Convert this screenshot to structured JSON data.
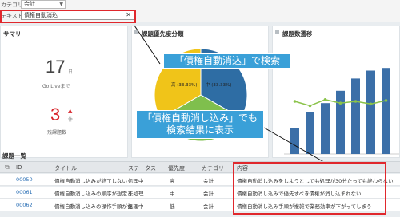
{
  "filters": {
    "category_label": "カテゴリ",
    "category_value": "会計",
    "text_label": "テキスト",
    "text_value": "債権自動消込"
  },
  "summary": {
    "title": "サマリ",
    "days_left": "17",
    "days_unit": "日",
    "go_live_label": "Go Liveまで",
    "remaining": "3",
    "remaining_unit": "件",
    "remaining_label": "残課題数"
  },
  "priority_panel": {
    "title": "課題優先度分類",
    "pie_high": "高 (33.33%)",
    "pie_mid": "中 (33.33%)",
    "pie_values": [
      33.33,
      33.33,
      33.34
    ],
    "colors": {
      "high": "#2e6da4",
      "mid": "#7fbf4d",
      "low": "#f0c419"
    }
  },
  "trend_panel": {
    "title": "課題数遷移",
    "bars": [
      0.3,
      0.48,
      0.58,
      0.72,
      0.86,
      0.95,
      0.98
    ],
    "line": [
      0.6,
      0.55,
      0.62,
      0.58,
      0.6,
      0.57,
      0.61
    ]
  },
  "callouts": {
    "top": "「債権自動消込」で検索",
    "bottom_line1": "「債権自動消し込み」でも",
    "bottom_line2": "検索結果に表示"
  },
  "list": {
    "title": "課題一覧",
    "headers": {
      "id": "ID",
      "title": "タイトル",
      "status": "ステータス",
      "priority": "優先度",
      "category": "カテゴリ",
      "content": "内容"
    },
    "rows": [
      {
        "id": "00050",
        "title": "債権自動消し込みが終了しない",
        "status": "処理中",
        "priority": "高",
        "category": "会計",
        "content": "債権自動消し込みをしようとしても処理が30分たっても終わらない"
      },
      {
        "id": "00061",
        "title": "債権自動消し込みの順序が想定と",
        "status": "未処理",
        "priority": "中",
        "category": "会計",
        "content": "債権自動消し込みで優先すべき債権が消し込まれない"
      },
      {
        "id": "00062",
        "title": "債権自動消し込みの操作手順が複",
        "status": "処理中",
        "priority": "低",
        "category": "会計",
        "content": "債権自動消し込み手順が複雑で業務効率が下がってしまう"
      }
    ]
  }
}
